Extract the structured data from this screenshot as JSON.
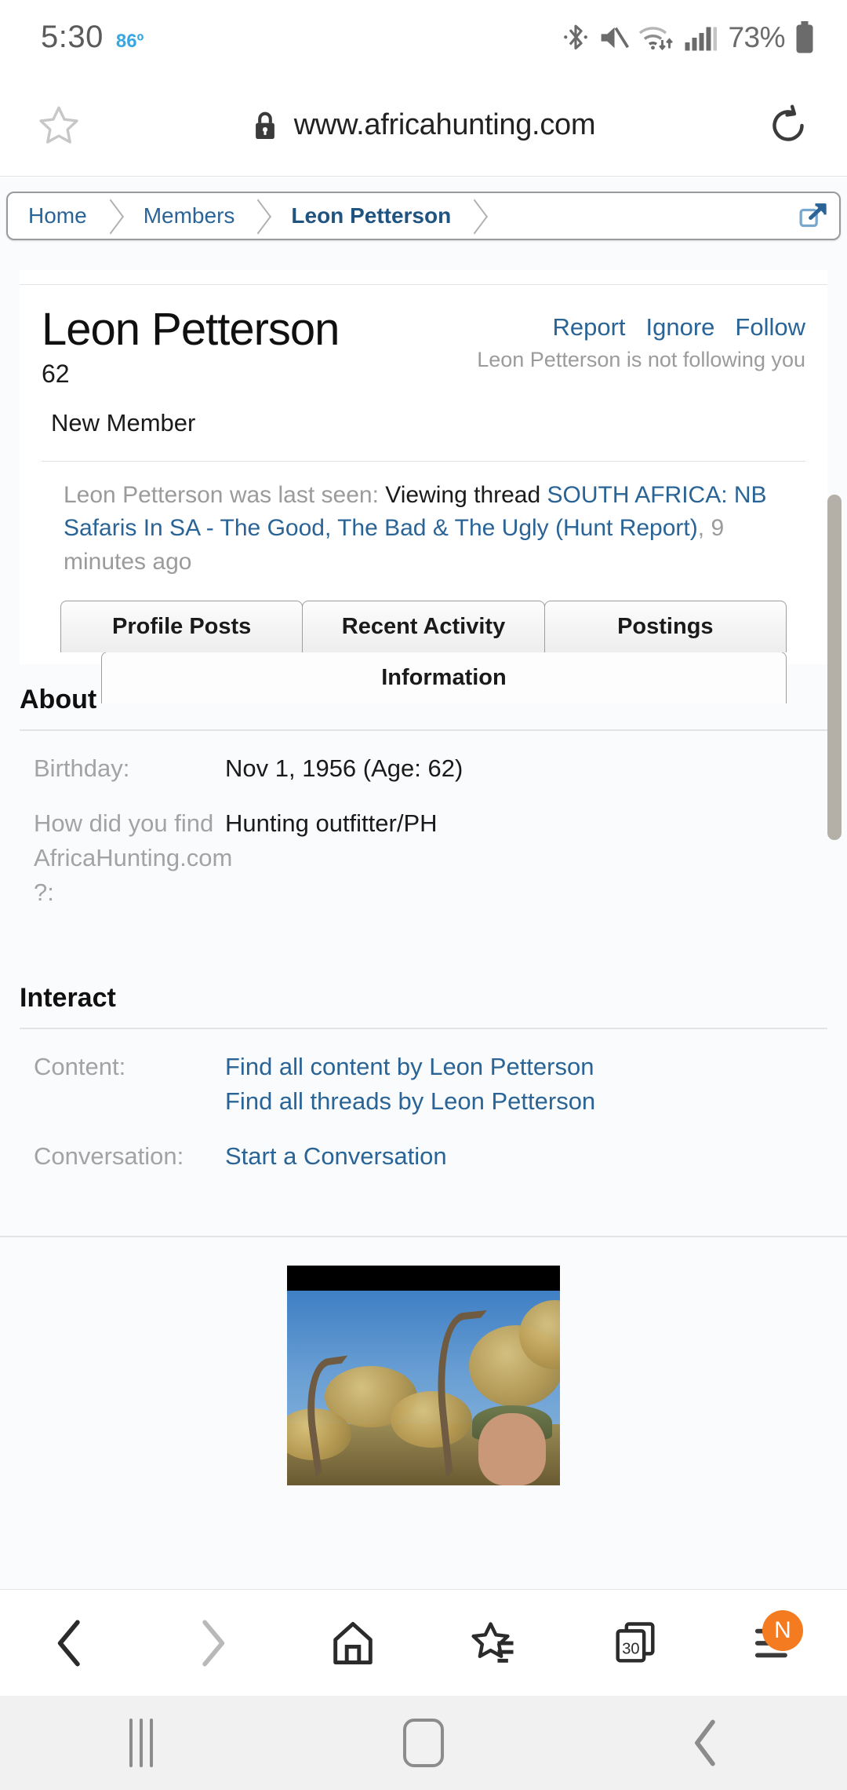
{
  "status_bar": {
    "time": "5:30",
    "temperature": "86º",
    "battery_percent": "73%",
    "icons": [
      "bluetooth-icon",
      "volume-muted-icon",
      "wifi-icon",
      "cellular-signal-icon",
      "battery-icon"
    ],
    "accent_color": "#39a7e0"
  },
  "url_bar": {
    "url": "www.africahunting.com",
    "star_icon": "bookmark-star-icon",
    "lock_icon": "secure-lock-icon",
    "reload_icon": "reload-icon"
  },
  "breadcrumb": {
    "items": [
      {
        "label": "Home",
        "current": false
      },
      {
        "label": "Members",
        "current": false
      },
      {
        "label": "Leon Petterson",
        "current": true
      }
    ],
    "external_link_icon": "external-link-icon"
  },
  "profile": {
    "name": "Leon Petterson",
    "age": "62",
    "rank": "New Member",
    "actions": [
      "Report",
      "Ignore",
      "Follow"
    ],
    "follow_note": "Leon Petterson is not following you",
    "last_seen": {
      "prefix": "Leon Petterson was last seen:",
      "activity": "Viewing thread",
      "thread": "SOUTH AFRICA: NB Safaris In SA - The Good, The Bad & The Ugly (Hunt Report)",
      "comma": ",",
      "time_ago": "9 minutes ago"
    }
  },
  "tabs": {
    "row1": [
      "Profile Posts",
      "Recent Activity",
      "Postings"
    ],
    "active": "Information"
  },
  "about": {
    "title": "About",
    "rows": [
      {
        "key": "Birthday:",
        "value": "Nov 1, 1956 (Age: 62)"
      },
      {
        "key": "How did you find AfricaHunting.com ?:",
        "value": "Hunting outfitter/PH"
      }
    ]
  },
  "interact": {
    "title": "Interact",
    "rows": [
      {
        "key": "Content:",
        "links": [
          "Find all content by Leon Petterson",
          "Find all threads by Leon Petterson"
        ]
      },
      {
        "key": "Conversation:",
        "links": [
          "Start a Conversation"
        ]
      }
    ]
  },
  "photo": {
    "alt": "hunting-photo-kudu-horns"
  },
  "browser_nav": {
    "buttons": [
      {
        "name": "back-button",
        "icon": "chevron-left-icon",
        "enabled": true
      },
      {
        "name": "forward-button",
        "icon": "chevron-right-icon",
        "enabled": false
      },
      {
        "name": "home-button",
        "icon": "home-icon",
        "enabled": true
      },
      {
        "name": "bookmarks-button",
        "icon": "bookmarks-star-icon",
        "enabled": true
      },
      {
        "name": "tabs-button",
        "icon": "tabs-icon",
        "enabled": true
      },
      {
        "name": "menu-button",
        "icon": "hamburger-menu-icon",
        "enabled": true
      }
    ],
    "tab_count": "30",
    "menu_badge": "N",
    "menu_badge_color": "#f47b20"
  },
  "android_nav": {
    "recents": "recents-icon",
    "home": "home-icon",
    "back": "back-icon"
  }
}
